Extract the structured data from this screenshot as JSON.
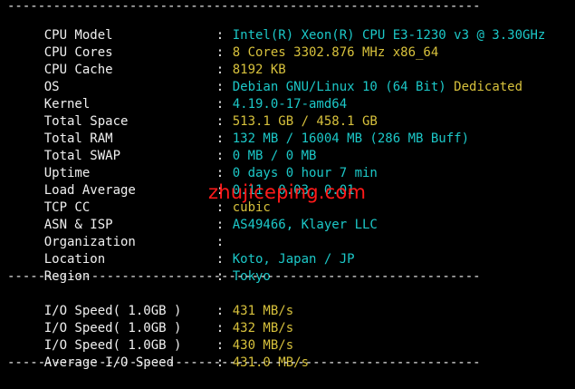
{
  "separator": "--------------------------------------------------------------",
  "colon": ":",
  "system_info": [
    {
      "label": "CPU Model",
      "value": "Intel(R) Xeon(R) CPU E3-1230 v3 @ 3.30GHz",
      "extra": ""
    },
    {
      "label": "CPU Cores",
      "value": "8 Cores 3302.876 MHz x86_64",
      "extra": ""
    },
    {
      "label": "CPU Cache",
      "value": "8192 KB",
      "extra": ""
    },
    {
      "label": "OS",
      "value": "Debian GNU/Linux 10 (64 Bit)",
      "extra": "Dedicated"
    },
    {
      "label": "Kernel",
      "value": "4.19.0-17-amd64",
      "extra": ""
    },
    {
      "label": "Total Space",
      "value": "513.1 GB / 458.1 GB",
      "extra": ""
    },
    {
      "label": "Total RAM",
      "value": "132 MB / 16004 MB (286 MB Buff)",
      "extra": ""
    },
    {
      "label": "Total SWAP",
      "value": "0 MB / 0 MB",
      "extra": ""
    },
    {
      "label": "Uptime",
      "value": "0 days 0 hour 7 min",
      "extra": ""
    },
    {
      "label": "Load Average",
      "value": "0.11, 0.03, 0.01",
      "extra": ""
    },
    {
      "label": "TCP CC",
      "value": "cubic",
      "extra": ""
    },
    {
      "label": "ASN & ISP",
      "value": "AS49466, Klayer LLC",
      "extra": ""
    },
    {
      "label": "Organization",
      "value": "",
      "extra": ""
    },
    {
      "label": "Location",
      "value": "Koto, Japan / JP",
      "extra": ""
    },
    {
      "label": "Region",
      "value": "Tokyo",
      "extra": ""
    }
  ],
  "io_speed": [
    {
      "label": "I/O Speed( 1.0GB )",
      "value": "431 MB/s"
    },
    {
      "label": "I/O Speed( 1.0GB )",
      "value": "432 MB/s"
    },
    {
      "label": "I/O Speed( 1.0GB )",
      "value": "430 MB/s"
    },
    {
      "label": "Average I/O Speed",
      "value": "431.0 MB/s"
    }
  ],
  "watermark": "zhujiceping.com",
  "colors": {
    "background": "#000000",
    "label": "#f0f0f0",
    "cyan": "#1cc8c8",
    "yellow": "#d7c13c",
    "watermark": "#ff1a1a"
  }
}
